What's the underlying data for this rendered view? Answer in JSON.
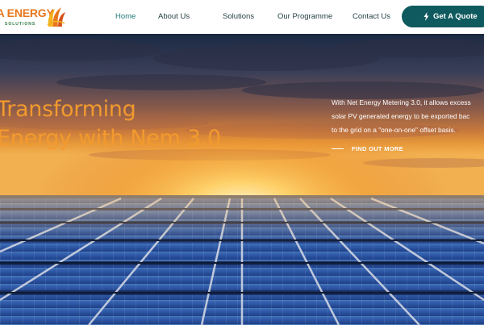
{
  "brand": {
    "name": "RIA ENERGY",
    "tagline": "SOLUTIONS",
    "logo_color": "#e8761c"
  },
  "nav": {
    "items": [
      {
        "label": "Home",
        "active": true
      },
      {
        "label": "About Us",
        "active": false
      },
      {
        "label": "Solutions",
        "active": false
      },
      {
        "label": "Our Programme",
        "active": false
      },
      {
        "label": "Contact Us",
        "active": false
      }
    ],
    "cta": {
      "label": "Get A Quote",
      "icon": "bolt-icon"
    }
  },
  "hero": {
    "headline_line1": "Transforming",
    "headline_line2": "Energy with Nem 3.0",
    "description": [
      "With Net Energy Metering 3.0, it allows excess",
      "solar PV generated energy to be exported bac",
      "to the grid on a \"one-on-one\" offset basis."
    ],
    "link_label": "FIND OUT MORE"
  },
  "colors": {
    "accent": "#f29a2e",
    "button": "#0f5a5e",
    "nav_active": "#1e7a74",
    "nav_text": "#1f3b3f"
  }
}
